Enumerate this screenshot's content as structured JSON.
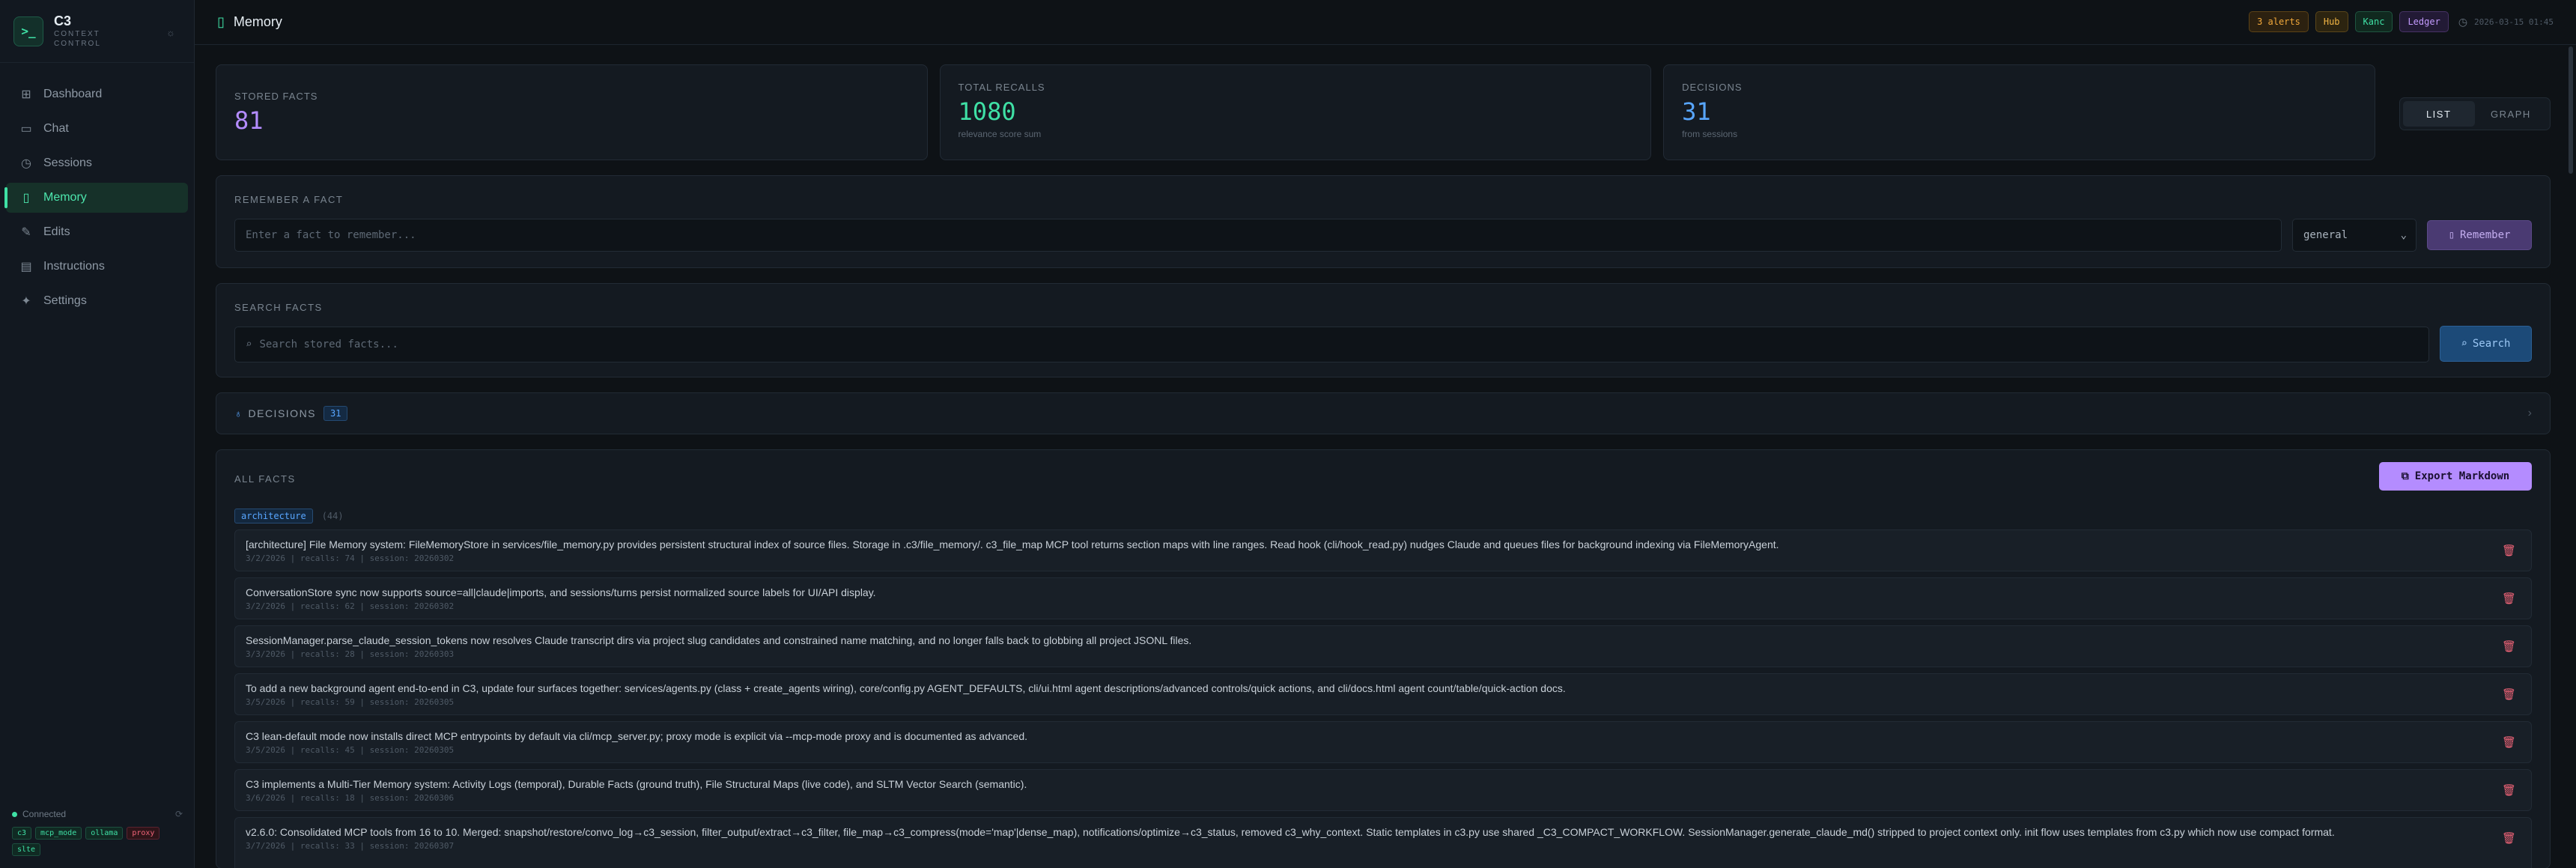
{
  "brand": {
    "title": "C3",
    "subtitle": "CONTEXT CONTROL"
  },
  "nav": [
    {
      "label": "Dashboard",
      "icon": "grid-icon",
      "glyph": "⊞"
    },
    {
      "label": "Chat",
      "icon": "chat-icon",
      "glyph": "▭"
    },
    {
      "label": "Sessions",
      "icon": "clock-icon",
      "glyph": "◷"
    },
    {
      "label": "Memory",
      "icon": "bookmark-icon",
      "glyph": "▯"
    },
    {
      "label": "Edits",
      "icon": "edit-icon",
      "glyph": "✎"
    },
    {
      "label": "Instructions",
      "icon": "file-icon",
      "glyph": "▤"
    },
    {
      "label": "Settings",
      "icon": "puzzle-icon",
      "glyph": "✦"
    }
  ],
  "status": {
    "connection": "Connected",
    "chips": [
      "c3",
      "mcp_mode",
      "ollama",
      "proxy",
      "slte"
    ]
  },
  "header": {
    "title": "Memory",
    "alerts": "3 alerts",
    "hub": "Hub",
    "kanc": "Kanc",
    "ledger": "Ledger",
    "timestamp": "2026-03-15 01:45"
  },
  "stats": {
    "stored": {
      "label": "STORED FACTS",
      "value": "81"
    },
    "recalls": {
      "label": "TOTAL RECALLS",
      "value": "1080",
      "sub": "relevance score sum"
    },
    "decisions": {
      "label": "DECISIONS",
      "value": "31",
      "sub": "from sessions"
    }
  },
  "view_toggle": {
    "list": "LIST",
    "graph": "GRAPH"
  },
  "remember": {
    "heading": "REMEMBER A FACT",
    "placeholder": "Enter a fact to remember...",
    "category": "general",
    "button": "Remember"
  },
  "search": {
    "heading": "SEARCH FACTS",
    "placeholder": "Search stored facts...",
    "button": "Search"
  },
  "decisions_panel": {
    "label": "DECISIONS",
    "count": "31"
  },
  "facts": {
    "heading": "ALL FACTS",
    "export": "Export Markdown",
    "category": "architecture",
    "category_count": "(44)",
    "items": [
      {
        "text": "[architecture] File Memory system: FileMemoryStore in services/file_memory.py provides persistent structural index of source files. Storage in .c3/file_memory/. c3_file_map MCP tool returns section maps with line ranges. Read hook (cli/hook_read.py) nudges Claude and queues files for background indexing via FileMemoryAgent.",
        "meta": "3/2/2026 | recalls: 74 | session: 20260302"
      },
      {
        "text": "ConversationStore sync now supports source=all|claude|imports, and sessions/turns persist normalized source labels for UI/API display.",
        "meta": "3/2/2026 | recalls: 62 | session: 20260302"
      },
      {
        "text": "SessionManager.parse_claude_session_tokens now resolves Claude transcript dirs via project slug candidates and constrained name matching, and no longer falls back to globbing all project JSONL files.",
        "meta": "3/3/2026 | recalls: 28 | session: 20260303"
      },
      {
        "text": "To add a new background agent end-to-end in C3, update four surfaces together: services/agents.py (class + create_agents wiring), core/config.py AGENT_DEFAULTS, cli/ui.html agent descriptions/advanced controls/quick actions, and cli/docs.html agent count/table/quick-action docs.",
        "meta": "3/5/2026 | recalls: 59 | session: 20260305"
      },
      {
        "text": "C3 lean-default mode now installs direct MCP entrypoints by default via cli/mcp_server.py; proxy mode is explicit via --mcp-mode proxy and is documented as advanced.",
        "meta": "3/5/2026 | recalls: 45 | session: 20260305"
      },
      {
        "text": "C3 implements a Multi-Tier Memory system: Activity Logs (temporal), Durable Facts (ground truth), File Structural Maps (live code), and SLTM Vector Search (semantic).",
        "meta": "3/6/2026 | recalls: 18 | session: 20260306"
      },
      {
        "text": "v2.6.0: Consolidated MCP tools from 16 to 10. Merged: snapshot/restore/convo_log→c3_session, filter_output/extract→c3_filter, file_map→c3_compress(mode='map'|dense_map), notifications/optimize→c3_status, removed c3_why_context. Static templates in c3.py use shared _C3_COMPACT_WORKFLOW. SessionManager.generate_claude_md() stripped to project context only. init flow uses templates from c3.py which now use compact format.",
        "meta": "3/7/2026 | recalls: 33 | session: 20260307"
      }
    ]
  }
}
